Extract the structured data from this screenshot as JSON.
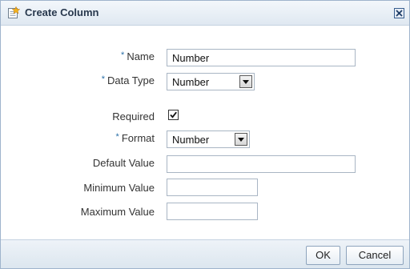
{
  "dialog": {
    "title": "Create Column",
    "title_icon": "new-column-icon",
    "close_icon": "close-icon"
  },
  "form": {
    "required_marker": "*",
    "name": {
      "label": "Name",
      "value": "Number",
      "required": true
    },
    "data_type": {
      "label": "Data Type",
      "selected": "Number",
      "required": true
    },
    "required": {
      "label": "Required",
      "checked": true
    },
    "format": {
      "label": "Format",
      "selected": "Number",
      "required": true
    },
    "default_value": {
      "label": "Default Value",
      "value": ""
    },
    "minimum_value": {
      "label": "Minimum Value",
      "value": ""
    },
    "maximum_value": {
      "label": "Maximum Value",
      "value": ""
    }
  },
  "footer": {
    "ok_label": "OK",
    "cancel_label": "Cancel"
  },
  "colors": {
    "required_marker": "#2a6fa8",
    "titlebar_start": "#f3f7fb",
    "titlebar_end": "#dfe8f1",
    "border": "#9fb4cc"
  }
}
